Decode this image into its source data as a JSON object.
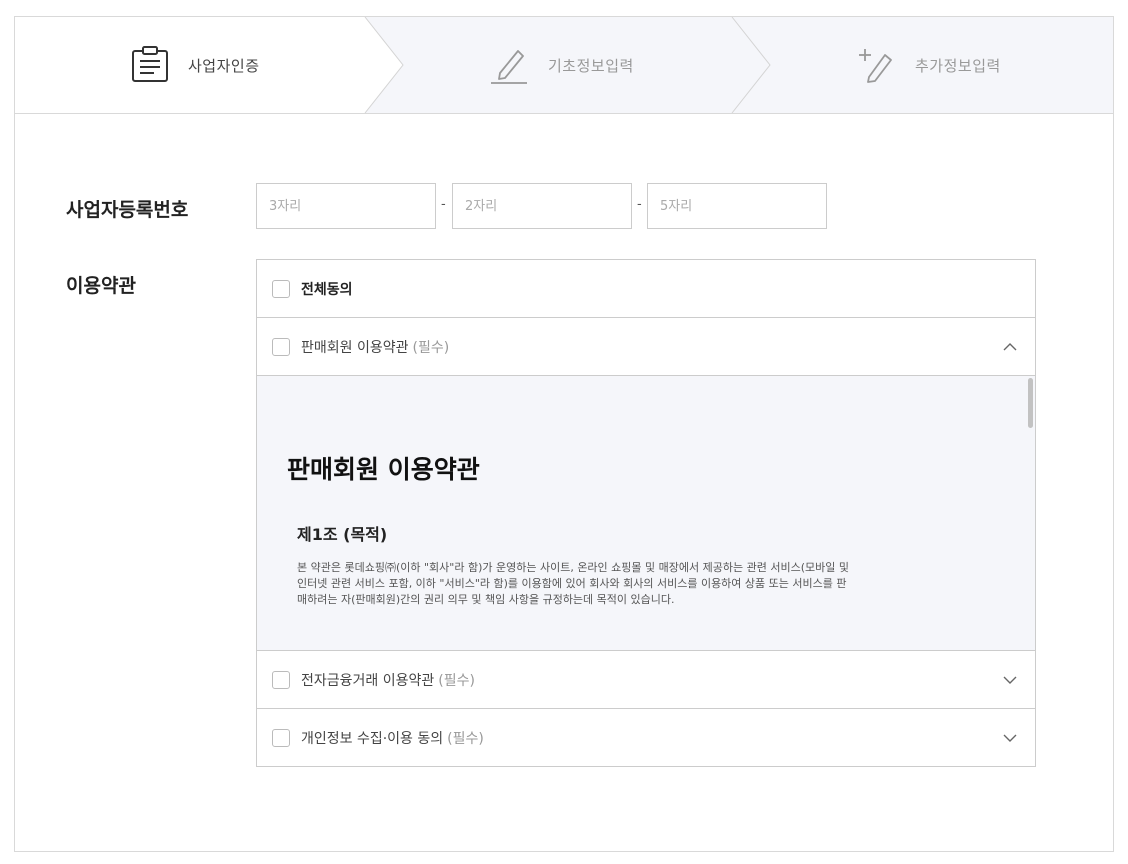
{
  "steps": [
    {
      "label": "사업자인증",
      "icon": "document-icon"
    },
    {
      "label": "기초정보입력",
      "icon": "pencil-icon"
    },
    {
      "label": "추가정보입력",
      "icon": "pencil-plus-icon"
    }
  ],
  "business_number": {
    "label": "사업자등록번호",
    "separator": "-",
    "fields": [
      {
        "placeholder": "3자리",
        "value": ""
      },
      {
        "placeholder": "2자리",
        "value": ""
      },
      {
        "placeholder": "5자리",
        "value": ""
      }
    ]
  },
  "terms": {
    "label": "이용약관",
    "agree_all": "전체동의",
    "items": [
      {
        "label": "판매회원 이용약관",
        "required": "(필수)",
        "expanded": true
      },
      {
        "label": "전자금융거래 이용약관",
        "required": "(필수)",
        "expanded": false
      },
      {
        "label": "개인정보 수집·이용 동의",
        "required": "(필수)",
        "expanded": false
      }
    ],
    "document": {
      "title": "판매회원 이용약관",
      "article_title": "제1조 (목적)",
      "article_lines": [
        "본 약관은 롯데쇼핑㈜(이하 \"회사\"라 함)가 운영하는 사이트, 온라인 쇼핑몰 및 매장에서 제공하는 관련 서비스(모바일 및",
        "인터넷 관련 서비스 포함, 이하 \"서비스\"라 함)를 이용함에 있어 회사와 회사의 서비스를 이용하여 상품 또는 서비스를 판",
        "매하려는 자(판매회원)간의 권리 의무 및 책임 사항을 규정하는데 목적이 있습니다."
      ]
    }
  },
  "colors": {
    "border": "#d9d9d9",
    "step_inactive_bg": "#f5f6fa",
    "accent_text": "#222222"
  }
}
